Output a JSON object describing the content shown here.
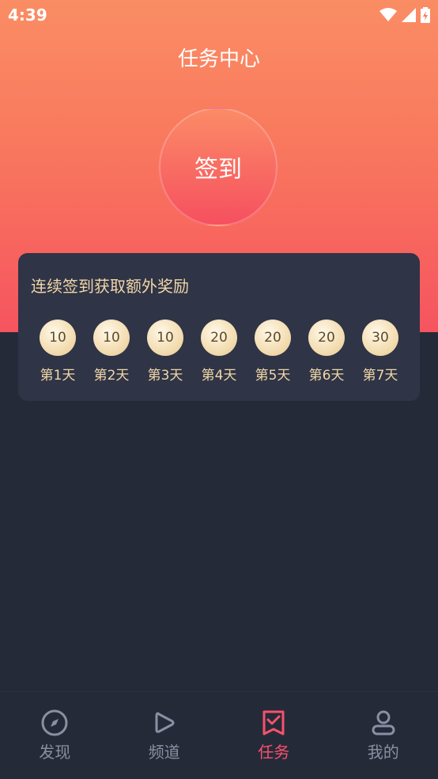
{
  "status_bar": {
    "time": "4:39"
  },
  "header": {
    "title": "任务中心"
  },
  "signin": {
    "label": "签到"
  },
  "reward_card": {
    "title": "连续签到获取额外奖励",
    "days": [
      {
        "points": "10",
        "label": "第1天"
      },
      {
        "points": "10",
        "label": "第2天"
      },
      {
        "points": "10",
        "label": "第3天"
      },
      {
        "points": "20",
        "label": "第4天"
      },
      {
        "points": "20",
        "label": "第5天"
      },
      {
        "points": "20",
        "label": "第6天"
      },
      {
        "points": "30",
        "label": "第7天"
      }
    ]
  },
  "tabbar": {
    "active_color": "#f6526b",
    "inactive_color": "#8a90a3",
    "items": [
      {
        "label": "发现",
        "icon": "compass-icon"
      },
      {
        "label": "频道",
        "icon": "play-icon"
      },
      {
        "label": "任务",
        "icon": "task-check-icon"
      },
      {
        "label": "我的",
        "icon": "user-icon"
      }
    ]
  }
}
